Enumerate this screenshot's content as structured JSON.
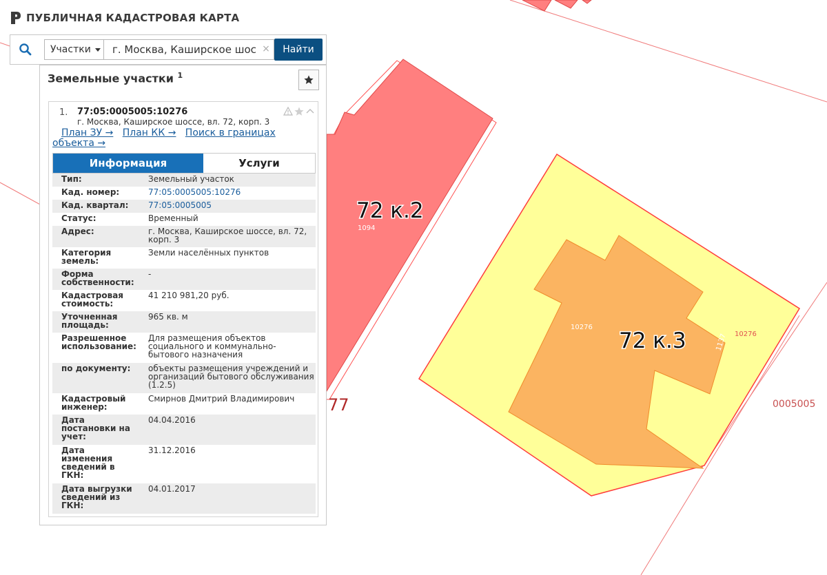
{
  "header": {
    "title": "ПУБЛИЧНАЯ КАДАСТРОВАЯ КАРТА"
  },
  "search": {
    "type_label": "Участки",
    "query": "г. Москва, Каширское шоссе, вл. 72, корп. 3",
    "clear": "×",
    "find_label": "Найти"
  },
  "panel": {
    "title": "Земельные участки",
    "count": "1",
    "result": {
      "number": "1.",
      "cad_number": "77:05:0005005:10276",
      "address": "г. Москва, Каширское шоссе, вл. 72, корп. 3",
      "links": [
        "План ЗУ →",
        "План КК →",
        "Поиск в границах объекта →"
      ]
    },
    "tabs": [
      "Информация",
      "Услуги"
    ],
    "rows": [
      {
        "label": "Тип:",
        "value": "Земельный участок"
      },
      {
        "label": "Кад. номер:",
        "value": "77:05:0005005:10276",
        "link": true
      },
      {
        "label": "Кад. квартал:",
        "value": "77:05:0005005",
        "link": true
      },
      {
        "label": "Статус:",
        "value": "Временный"
      },
      {
        "label": "Адрес:",
        "value": "г. Москва, Каширское шоссе, вл. 72, корп. 3"
      },
      {
        "label": "Категория земель:",
        "value": "Земли населённых пунктов"
      },
      {
        "label": "Форма собственности:",
        "value": "-"
      },
      {
        "label": "Кадастровая стоимость:",
        "value": "41 210 981,20 руб."
      },
      {
        "label": "Уточненная площадь:",
        "value": "965 кв. м"
      },
      {
        "label": "Разрешенное использование:",
        "value": "Для размещения объектов социального и коммунально-бытового назначения"
      },
      {
        "label": "по документу:",
        "value": "объекты размещения учреждений и организаций бытового обслуживания (1.2.5)"
      },
      {
        "label": "Кадастровый инженер:",
        "value": "Смирнов Дмитрий Владимирович"
      },
      {
        "label": "Дата постановки на учет:",
        "value": "04.04.2016"
      },
      {
        "label": "Дата изменения сведений в ГКН:",
        "value": "31.12.2016"
      },
      {
        "label": "Дата выгрузки сведений из ГКН:",
        "value": "04.01.2017"
      }
    ]
  },
  "map": {
    "building_k2_label": "72 к.2",
    "building_k2_number": "1094",
    "building_k3_label": "72 к.3",
    "parcel_number_left": "10276",
    "parcel_number_right": "10276",
    "vertical_number": "1137",
    "quarter_label": "0005005",
    "district_label": "77"
  },
  "colors": {
    "parcel_fill": "#ffff99",
    "parcel_stroke": "#ff3b3b",
    "building_red": "#ff7f7f",
    "building_orange": "#fbb461",
    "accent_blue": "#1870b8",
    "button_dark": "#0b4f81"
  }
}
